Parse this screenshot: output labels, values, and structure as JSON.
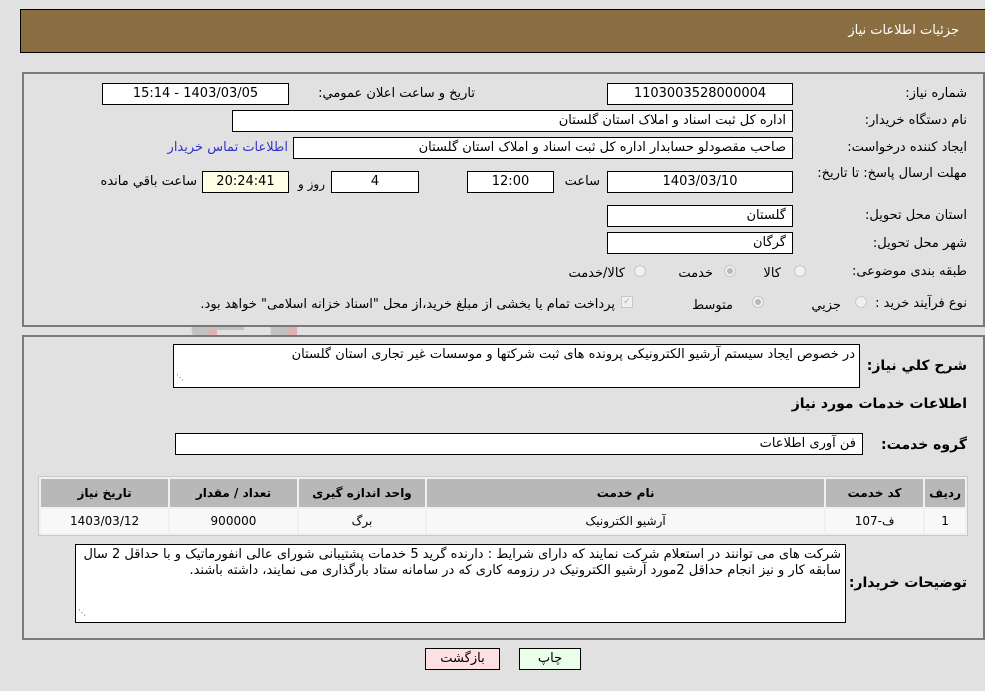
{
  "header": {
    "title": "جزئیات اطلاعات نیاز"
  },
  "form": {
    "need_number_label": "شماره نیاز:",
    "need_number": "1103003528000004",
    "announce_label": "تاریخ و ساعت اعلان عمومي:",
    "announce_value": "1403/03/05 - 15:14",
    "buyer_org_label": "نام دستگاه خریدار:",
    "buyer_org": "اداره کل ثبت اسناد و املاک استان گلستان",
    "requester_label": "ایجاد کننده درخواست:",
    "requester": "صاحب مقصودلو حسابدار اداره کل ثبت اسناد و املاک استان گلستان",
    "contact_link": "اطلاعات تماس خریدار",
    "deadline_label": "مهلت ارسال پاسخ: تا تاریخ:",
    "deadline_date": "1403/03/10",
    "time_label": "ساعت",
    "deadline_time": "12:00",
    "days_value": "4",
    "days_label": "روز و",
    "remaining_time": "20:24:41",
    "remaining_label": "ساعت باقي مانده",
    "province_label": "استان محل تحویل:",
    "province": "گلستان",
    "city_label": "شهر محل تحویل:",
    "city": "گرگان",
    "category_label": "طبقه بندی موضوعی:",
    "category_options": [
      "کالا",
      "خدمت",
      "کالا/خدمت"
    ],
    "category_selected": "خدمت",
    "process_label": "نوع فرآیند خرید :",
    "process_options": [
      "جزيي",
      "متوسط"
    ],
    "process_selected": "متوسط",
    "treasury_note": "پرداخت تمام یا بخشی از مبلغ خرید،از محل \"اسناد خزانه اسلامی\" خواهد بود."
  },
  "details": {
    "summary_label": "شرح کلي نياز:",
    "summary": "در خصوص ایجاد سیستم آرشیو الکترونیکی پرونده های ثبت شرکتها و موسسات غیر تجاری  استان گلستان",
    "services_heading": "اطلاعات خدمات مورد نياز",
    "service_group_label": "گروه خدمت:",
    "service_group": "فن آوری اطلاعات",
    "table": {
      "headers": [
        "رديف",
        "کد خدمت",
        "نام خدمت",
        "واحد اندازه گیری",
        "تعداد / مقدار",
        "تاريخ نياز"
      ],
      "rows": [
        [
          "1",
          "ف-107",
          "آرشیو الکترونیک",
          "برگ",
          "900000",
          "1403/03/12"
        ]
      ]
    },
    "buyer_notes_label": "توضیحات خریدار:",
    "buyer_notes": "شرکت های می توانند در استعلام شرکت نمایند که دارای شرایط : دارنده گرید 5 خدمات پشتیبانی شورای عالی انفورماتیک و با حداقل 2 سال سابقه کار و نیز انجام حداقل 2مورد آرشیو الکترونیک در رزومه کاری که در سامانه ستاد بارگذاری می نمایند،  داشته باشند."
  },
  "buttons": {
    "print": "چاپ",
    "back": "بازگشت"
  },
  "colors": {
    "header_bg": "#8b6d42",
    "print_bg": "#eaffea",
    "back_bg": "#ffe0e0",
    "link": "#3333cc"
  }
}
